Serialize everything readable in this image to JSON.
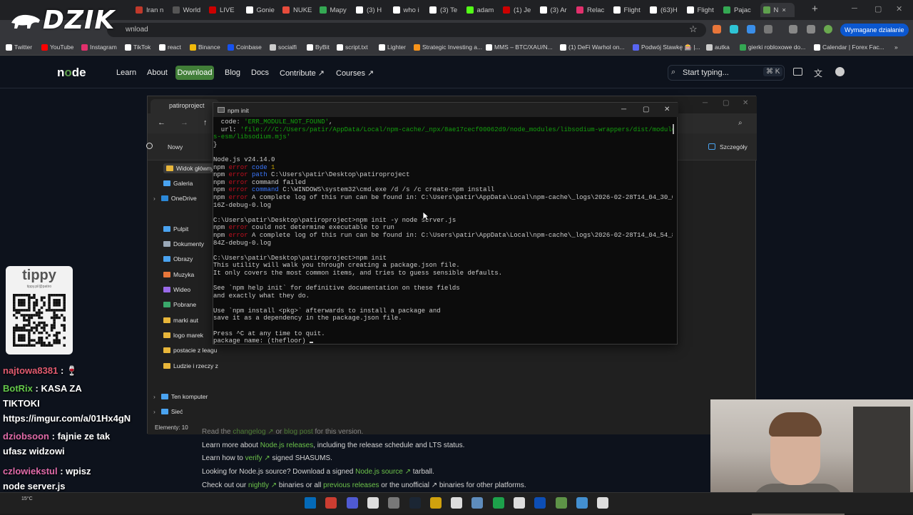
{
  "browser": {
    "tabs": [
      {
        "label": "Iran n",
        "color": "#c0392b"
      },
      {
        "label": "World",
        "color": "#555555"
      },
      {
        "label": "LIVE",
        "color": "#cc0000"
      },
      {
        "label": "Gonie",
        "color": "#ffffff"
      },
      {
        "label": "NUKE",
        "color": "#e74c3c"
      },
      {
        "label": "Mapy",
        "color": "#34a853"
      },
      {
        "label": "(3) H",
        "color": "#ffffff"
      },
      {
        "label": "who i",
        "color": "#ffffff"
      },
      {
        "label": "(3) Te",
        "color": "#ffffff"
      },
      {
        "label": "adam",
        "color": "#53fc18"
      },
      {
        "label": "(1) Je",
        "color": "#cc0000"
      },
      {
        "label": "(3) Ar",
        "color": "#ffffff"
      },
      {
        "label": "Relac",
        "color": "#e1306c"
      },
      {
        "label": "Flight",
        "color": "#ffffff"
      },
      {
        "label": "(63)H",
        "color": "#ffffff"
      },
      {
        "label": "Flight",
        "color": "#ffffff"
      },
      {
        "label": "Pajac",
        "color": "#34a853"
      },
      {
        "label": "N",
        "color": "#5fa04e"
      }
    ],
    "active_tab_close": "×",
    "new_tab": "+",
    "url_fragment": "wnload",
    "update_button": "Wymagane działanie",
    "bookmarks": [
      {
        "label": "Twitter",
        "color": "#ffffff"
      },
      {
        "label": "YouTube",
        "color": "#ff0000"
      },
      {
        "label": "Instagram",
        "color": "#e1306c"
      },
      {
        "label": "TikTok",
        "color": "#ffffff"
      },
      {
        "label": "react",
        "color": "#ffffff"
      },
      {
        "label": "Binance",
        "color": "#f0b90b"
      },
      {
        "label": "Coinbase",
        "color": "#1652f0"
      },
      {
        "label": "socialfi",
        "color": "#cccccc"
      },
      {
        "label": "ByBit",
        "color": "#ffffff"
      },
      {
        "label": "script.txt",
        "color": "#ffffff"
      },
      {
        "label": "Lighter",
        "color": "#ffffff"
      },
      {
        "label": "Strategic Investing a...",
        "color": "#f7931a"
      },
      {
        "label": "MMS – BTC/XAU/N...",
        "color": "#ffffff"
      },
      {
        "label": "(1) DeFi Warhol on...",
        "color": "#ffffff"
      },
      {
        "label": "Podwój Stawkę 🎰 |...",
        "color": "#5865f2"
      },
      {
        "label": "autka",
        "color": "#cccccc"
      },
      {
        "label": "gierki robloxowe do...",
        "color": "#34a853"
      },
      {
        "label": "Calendar | Forex Fac...",
        "color": "#ffffff"
      }
    ]
  },
  "overlay": {
    "brand": "DZIK",
    "qr_title": "tippy",
    "qr_sub": "tippy.pl/@patiro",
    "chat": [
      {
        "user": "najtowa8381",
        "sep": " : ",
        "msg": "🍷"
      },
      {
        "user": "BotRix",
        "sep": " : ",
        "msg": "KASA ZA"
      },
      {
        "user": "",
        "sep": "",
        "msg": "TIKTOKI"
      },
      {
        "user": "",
        "sep": "",
        "msg": "https://imgur.com/a/01Hx4gN"
      },
      {
        "user": "dziobsoon",
        "sep": " : ",
        "msg": "fajnie ze tak"
      },
      {
        "user": "",
        "sep": "",
        "msg": "ufasz widzowi"
      },
      {
        "user": "czlowiekstul",
        "sep": " : ",
        "msg": "wpisz"
      },
      {
        "user": "",
        "sep": "",
        "msg": "node server.js"
      },
      {
        "user": "najtowa8381",
        "sep": " : ",
        "msg": "🍷"
      }
    ]
  },
  "node_site": {
    "logo_a": "n",
    "logo_b": "o",
    "logo_c": "de",
    "nav": [
      "Learn",
      "About",
      "Download",
      "Blog",
      "Docs",
      "Contribute ↗",
      "Courses ↗"
    ],
    "search_placeholder": "Start typing...",
    "search_shortcut": "⌘ K",
    "lines": [
      {
        "pre": "Read the ",
        "link": "changelog ↗",
        "mid": " or ",
        "link2": "blog post",
        "post": " for this version."
      },
      {
        "pre": "Learn more about ",
        "link": "Node.js releases",
        "mid": ", including the release schedule and LTS status.",
        "link2": "",
        "post": ""
      },
      {
        "pre": "Learn how to ",
        "link": "verify ↗",
        "mid": " signed SHASUMS.",
        "link2": "",
        "post": ""
      },
      {
        "pre": "Looking for Node.js source? Download a signed ",
        "link": "Node.js source ↗",
        "mid": " tarball.",
        "link2": "",
        "post": ""
      },
      {
        "pre": "Check out our ",
        "link": "nightly ↗",
        "mid": " binaries or all ",
        "link2": "previous releases",
        "post": " or the unofficial ↗ binaries for other platforms."
      }
    ]
  },
  "explorer": {
    "tab_title": "patiroproject",
    "search_hint": "ct",
    "new_button": "Nowy",
    "details_button": "Szczegóły",
    "nav_items": [
      {
        "label": "Widok główny",
        "color": "#e8b63a"
      },
      {
        "label": "Galeria",
        "color": "#4aa3f0"
      },
      {
        "label": "OneDrive",
        "color": "#2b88d8"
      },
      {
        "label": "Pulpit",
        "color": "#4aa3f0"
      },
      {
        "label": "Dokumenty",
        "color": "#9aa8b8"
      },
      {
        "label": "Obrazy",
        "color": "#4aa3f0"
      },
      {
        "label": "Muzyka",
        "color": "#e8763a"
      },
      {
        "label": "Wideo",
        "color": "#9a6ae8"
      },
      {
        "label": "Pobrane",
        "color": "#3aa86b"
      },
      {
        "label": "marki aut",
        "color": "#e8b63a"
      },
      {
        "label": "logo marek",
        "color": "#e8b63a"
      },
      {
        "label": "postacie z leagu",
        "color": "#e8b63a"
      },
      {
        "label": "Ludzie i rzeczy z",
        "color": "#e8b63a"
      },
      {
        "label": "Ten komputer",
        "color": "#4aa3f0"
      },
      {
        "label": "Sieć",
        "color": "#4aa3f0"
      }
    ],
    "status": "Elementy: 10"
  },
  "terminal": {
    "title": "npm init",
    "lines": [
      [
        {
          "t": "  code: "
        },
        {
          "t": "'ERR_MODULE_NOT_FOUND'",
          "c": "grn"
        },
        {
          "t": ","
        }
      ],
      [
        {
          "t": "  url: "
        },
        {
          "t": "'file:///C:/Users/patir/AppData/Local/npm-cache/_npx/8ae17cecf00062d9/node_modules/libsodium-wrappers/dist/module",
          "c": "grn"
        }
      ],
      [
        {
          "t": "s-esm/libsodium.mjs'",
          "c": "grn"
        }
      ],
      [
        {
          "t": "}"
        }
      ],
      [
        {
          "t": ""
        }
      ],
      [
        {
          "t": "Node.js v24.14.0"
        }
      ],
      [
        {
          "t": "npm "
        },
        {
          "t": "error",
          "c": "err"
        },
        {
          "t": " code",
          "c": "blue"
        },
        {
          "t": " 1",
          "c": "yel"
        }
      ],
      [
        {
          "t": "npm "
        },
        {
          "t": "error",
          "c": "err"
        },
        {
          "t": " path",
          "c": "blue"
        },
        {
          "t": " C:\\Users\\patir\\Desktop\\patiroproject"
        }
      ],
      [
        {
          "t": "npm "
        },
        {
          "t": "error",
          "c": "err"
        },
        {
          "t": " command failed"
        }
      ],
      [
        {
          "t": "npm "
        },
        {
          "t": "error",
          "c": "err"
        },
        {
          "t": " command",
          "c": "blue"
        },
        {
          "t": " C:\\WINDOWS\\system32\\cmd.exe /d /s /c create-npm install"
        }
      ],
      [
        {
          "t": "npm "
        },
        {
          "t": "error",
          "c": "err"
        },
        {
          "t": " A complete log of this run can be found in: C:\\Users\\patir\\AppData\\Local\\npm-cache\\_logs\\2026-02-28T14_04_30_0"
        }
      ],
      [
        {
          "t": "16Z-debug-0.log"
        }
      ],
      [
        {
          "t": ""
        }
      ],
      [
        {
          "t": "C:\\Users\\patir\\Desktop\\patiroproject>npm init -y node server.js"
        }
      ],
      [
        {
          "t": "npm "
        },
        {
          "t": "error",
          "c": "err"
        },
        {
          "t": " could not determine executable to run"
        }
      ],
      [
        {
          "t": "npm "
        },
        {
          "t": "error",
          "c": "err"
        },
        {
          "t": " A complete log of this run can be found in: C:\\Users\\patir\\AppData\\Local\\npm-cache\\_logs\\2026-02-28T14_04_54_8"
        }
      ],
      [
        {
          "t": "84Z-debug-0.log"
        }
      ],
      [
        {
          "t": ""
        }
      ],
      [
        {
          "t": "C:\\Users\\patir\\Desktop\\patiroproject>npm init"
        }
      ],
      [
        {
          "t": "This utility will walk you through creating a package.json file."
        }
      ],
      [
        {
          "t": "It only covers the most common items, and tries to guess sensible defaults."
        }
      ],
      [
        {
          "t": ""
        }
      ],
      [
        {
          "t": "See `npm help init` for definitive documentation on these fields"
        }
      ],
      [
        {
          "t": "and exactly what they do."
        }
      ],
      [
        {
          "t": ""
        }
      ],
      [
        {
          "t": "Use `npm install <pkg>` afterwards to install a package and"
        }
      ],
      [
        {
          "t": "save it as a dependency in the package.json file."
        }
      ],
      [
        {
          "t": ""
        }
      ],
      [
        {
          "t": "Press ^C at any time to quit."
        }
      ],
      [
        {
          "t": "package name: (thefloor) "
        }
      ]
    ]
  },
  "taskbar": {
    "weather": "15°C",
    "icons": [
      "#0078d4",
      "#ea4335",
      "#5865f2",
      "#ffffff",
      "#888888",
      "#1b2838",
      "#f0b90b",
      "#ffffff",
      "#6aa0d8",
      "#1db954",
      "#ffffff",
      "#0b57d0",
      "#6aa84f",
      "#4aa3f0",
      "#ffffff"
    ]
  }
}
